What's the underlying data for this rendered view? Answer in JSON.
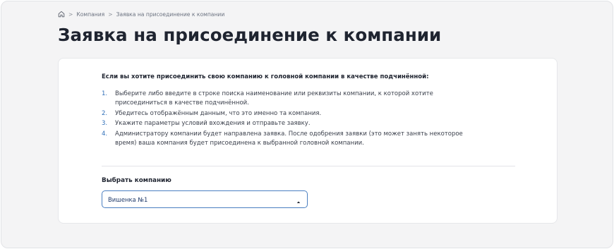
{
  "breadcrumb": {
    "home_icon": "home-icon",
    "separator": ">",
    "items": [
      "Компания",
      "Заявка на присоединение к компании"
    ]
  },
  "page": {
    "title": "Заявка на присоединение к компании"
  },
  "card": {
    "intro": "Если вы хотите присоединить свою компанию к головной компании в качестве подчинённой:",
    "steps": [
      {
        "num": "1.",
        "text": "Выберите либо введите в строке поиска наименование или реквизиты компании, к которой хотите присоединиться в качестве подчинённой."
      },
      {
        "num": "2.",
        "text": "Убедитесь отображённым данным, что это именно та компания."
      },
      {
        "num": "3.",
        "text": "Укажите параметры условий вхождения и отправьте заявку."
      },
      {
        "num": "4.",
        "text": "Администратору компании будет направлена заявка. После одобрения заявки (это может занять некоторое время) ваша компания будет присоединена к выбранной головной компании."
      }
    ],
    "select": {
      "label": "Выбрать компанию",
      "value": "Вишенка №1",
      "icon": "chevron-up-icon"
    }
  },
  "colors": {
    "accent": "#2f6fb8",
    "select_border": "#4a7fc1",
    "background": "#f4f4f5",
    "card": "#ffffff"
  }
}
